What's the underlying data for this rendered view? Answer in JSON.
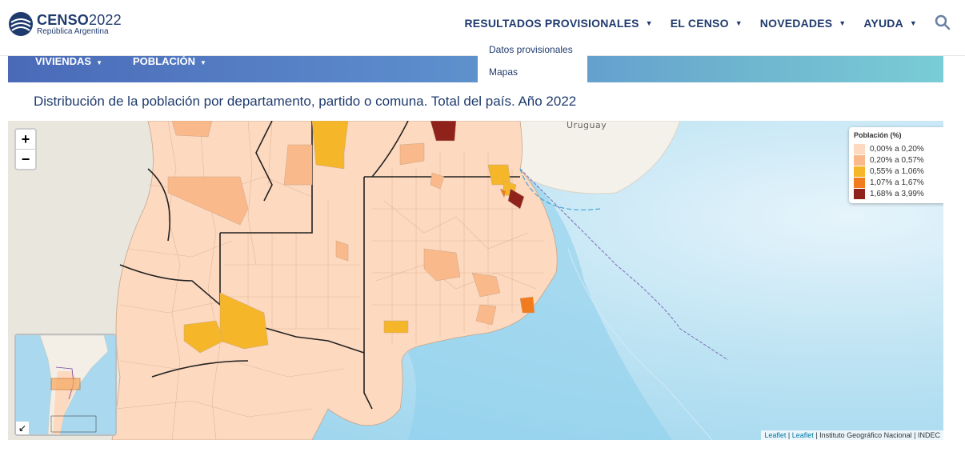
{
  "header": {
    "logo": {
      "title_bold": "CENSO",
      "title_year": "2022",
      "subtitle": "República Argentina"
    },
    "nav": [
      {
        "label": "RESULTADOS PROVISIONALES"
      },
      {
        "label": "EL CENSO"
      },
      {
        "label": "NOVEDADES"
      },
      {
        "label": "AYUDA"
      }
    ],
    "search_icon": "search-icon"
  },
  "band": {
    "items": [
      {
        "label": "VIVIENDAS"
      },
      {
        "label": "POBLACIÓN"
      }
    ]
  },
  "dropdown": {
    "items": [
      {
        "label": "Datos provisionales"
      },
      {
        "label": "Mapas"
      }
    ]
  },
  "page_title": "Distribución de la población por departamento, partido o comuna. Total del país. Año 2022",
  "map": {
    "zoom_in": "+",
    "zoom_out": "−",
    "place_label": "Uruguay",
    "legend": {
      "title": "Población (%)",
      "entries": [
        {
          "label": "0,00% a 0,20%",
          "color": "#fdd9bf"
        },
        {
          "label": "0,20% a 0,57%",
          "color": "#f9b98a"
        },
        {
          "label": "0,55% a 1,06%",
          "color": "#f5b62a"
        },
        {
          "label": "1,07% a 1,67%",
          "color": "#f07c1d"
        },
        {
          "label": "1,68% a 3,99%",
          "color": "#8f231c"
        }
      ]
    },
    "attribution": {
      "link1": "Leaflet",
      "sep1": " | ",
      "link2": "Leaflet",
      "sep2": " | ",
      "text": "Instituto Geográfico Nacional | INDEC"
    },
    "minimap_toggle": "↙"
  },
  "colors": {
    "brand": "#1f3b6e",
    "water": "#b9e1f2",
    "land_base": "#fdd9bf"
  }
}
